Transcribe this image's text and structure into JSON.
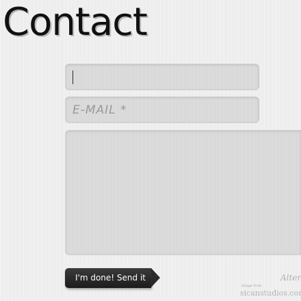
{
  "page": {
    "title": "Contact"
  },
  "form": {
    "name_field": {
      "placeholder": "",
      "value": ""
    },
    "email_field": {
      "placeholder": "E-MAIL *",
      "value": ""
    },
    "message_field": {
      "placeholder": "",
      "value": ""
    },
    "submit_label": "I'm done! Send it"
  },
  "footer": {
    "alt_link_partial": "Alter",
    "credit_label": "Image from",
    "credit_site": "sicanstudios.com"
  },
  "colors": {
    "title": "#111111",
    "button_bg": "#2a2a2a",
    "button_text": "#ffffff",
    "field_bg": "#dcdcdc",
    "placeholder": "#999999"
  }
}
